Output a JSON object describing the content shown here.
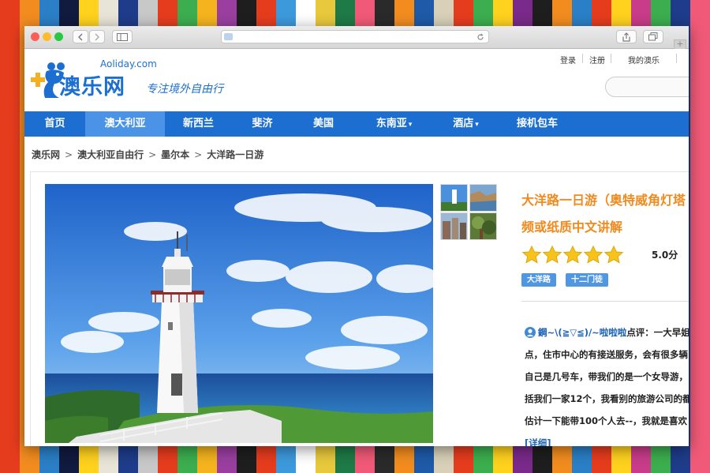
{
  "background_stripes": [
    "#e63c1e",
    "#f28c1f",
    "#2a7fc6",
    "#111a3f",
    "#ffd21e",
    "#e8e4d8",
    "#1e3c8a",
    "#c8c8c8",
    "#e63c1e",
    "#3cae4f",
    "#f5b41e",
    "#9a3fa0",
    "#1e1e1e",
    "#e63c1e",
    "#3c9adc",
    "#ffffff",
    "#e8c83c",
    "#1e7a46",
    "#f05a78",
    "#2a2a2a",
    "#f28c1f",
    "#1e5aa8",
    "#d8d0b8",
    "#e63c1e",
    "#3cae4f",
    "#ffd21e",
    "#7a2a8a",
    "#1e1e1e",
    "#f28c1f",
    "#2a7fc6",
    "#e63c1e",
    "#ffd21e",
    "#c83c8a",
    "#3cae4f",
    "#1e3c8a",
    "#f05a78"
  ],
  "browser": {
    "traffic_lights": [
      "#fc5f57",
      "#fdbc2e",
      "#28c840"
    ],
    "back_icon": "chevron-left-icon",
    "forward_icon": "chevron-right-icon",
    "sidebar_icon": "sidebar-icon",
    "reload_icon": "reload-icon",
    "share_icon": "share-icon",
    "tabs_icon": "tabs-icon"
  },
  "site": {
    "logo_domain": "Aoliday.com",
    "logo_name": "澳乐网",
    "logo_slogan": "专注境外自由行",
    "brand_color": "#1c6fd1",
    "accent_color": "#f08a1e"
  },
  "top_links": {
    "login": "登录",
    "register": "注册",
    "my_account": "我的澳乐"
  },
  "nav": {
    "items": [
      {
        "label": "首页",
        "dropdown": false
      },
      {
        "label": "澳大利亚",
        "dropdown": false,
        "active": true
      },
      {
        "label": "新西兰",
        "dropdown": false
      },
      {
        "label": "斐济",
        "dropdown": false
      },
      {
        "label": "美国",
        "dropdown": false
      },
      {
        "label": "东南亚",
        "dropdown": true
      },
      {
        "label": "酒店",
        "dropdown": true
      },
      {
        "label": "接机包车",
        "dropdown": false
      }
    ],
    "caret": "▾"
  },
  "breadcrumb": {
    "items": [
      "澳乐网",
      "澳大利亚自由行",
      "墨尔本",
      "大洋路一日游"
    ],
    "separator": ">"
  },
  "product": {
    "title_line1": "大洋路一日游（奥特威角灯塔",
    "title_line2": "频或纸质中文讲解",
    "rating": 5,
    "score": "5.0分",
    "tags": [
      "大洋路",
      "十二门徒"
    ]
  },
  "review": {
    "user": "鋼~\\(≧▽≦)/~啦啦啦",
    "prefix": "点评：一大早姐妹",
    "lines": [
      "点，住市中心的有接送服务，会有很多辆",
      "自己是几号车，带我们的是一个女导游，",
      "括我们一家12个，我看别的旅游公司的都",
      "估计一下能带100个人去--，我就是喜欢"
    ],
    "more": "[详细]"
  }
}
